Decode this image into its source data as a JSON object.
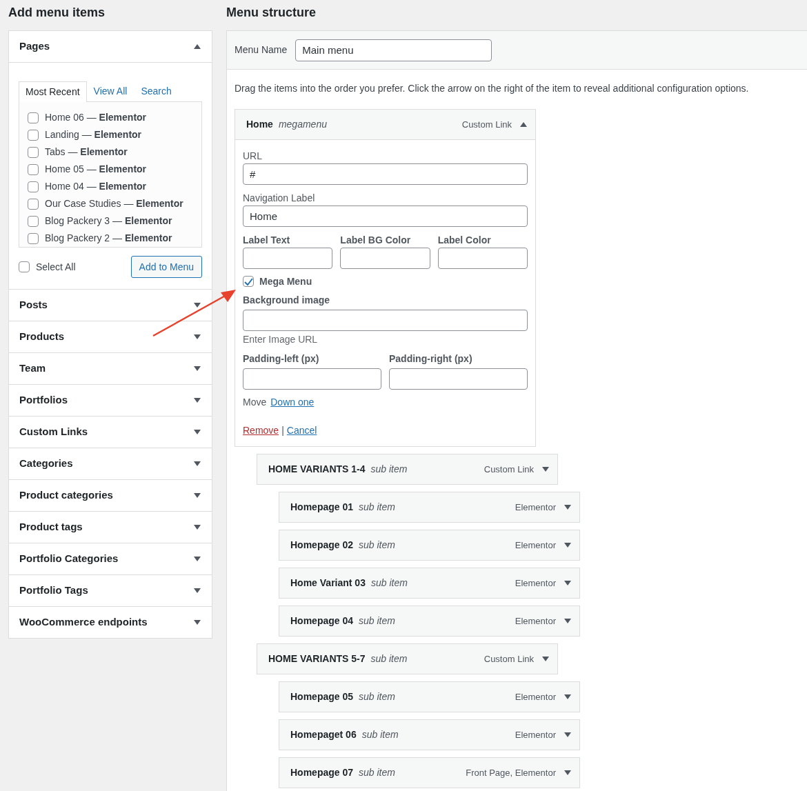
{
  "add_menu_items": {
    "title": "Add menu items",
    "sections": [
      {
        "title": "Pages",
        "expanded": true,
        "tabs": [
          {
            "label": "Most Recent",
            "selected": true
          },
          {
            "label": "View All",
            "selected": false
          },
          {
            "label": "Search",
            "selected": false
          }
        ],
        "pages": [
          {
            "label": "Home 06 — **Elementor**",
            "checked": false
          },
          {
            "label": "Landing — **Elementor**",
            "checked": false
          },
          {
            "label": "Tabs — **Elementor**",
            "checked": false
          },
          {
            "label": "Home 05 — **Elementor**",
            "checked": false
          },
          {
            "label": "Home 04 — **Elementor**",
            "checked": false
          },
          {
            "label": "Our Case Studies — **Elementor**",
            "checked": false
          },
          {
            "label": "Blog Packery 3 — **Elementor**",
            "checked": false
          },
          {
            "label": "Blog Packery 2 — **Elementor**",
            "checked": false
          }
        ],
        "select_all": {
          "label": "Select All",
          "checked": false
        },
        "button": "Add to Menu"
      },
      {
        "title": "Posts",
        "expanded": false
      },
      {
        "title": "Products",
        "expanded": false
      },
      {
        "title": "Team",
        "expanded": false
      },
      {
        "title": "Portfolios",
        "expanded": false
      },
      {
        "title": "Custom Links",
        "expanded": false
      },
      {
        "title": "Categories",
        "expanded": false
      },
      {
        "title": "Product categories",
        "expanded": false
      },
      {
        "title": "Product tags",
        "expanded": false
      },
      {
        "title": "Portfolio Categories",
        "expanded": false
      },
      {
        "title": "Portfolio Tags",
        "expanded": false
      },
      {
        "title": "WooCommerce endpoints",
        "expanded": false
      }
    ]
  },
  "menu_structure": {
    "title": "Menu structure",
    "menu_name": {
      "label": "Menu Name",
      "value": "Main menu"
    },
    "instructions": "Drag the items into the order you prefer. Click the arrow on the right of the item to reveal additional configuration options.",
    "items": [
      {
        "title": "Home",
        "subtitle": "megamenu",
        "type": "Custom Link",
        "expanded": true,
        "settings": {
          "url": {
            "label": "URL",
            "value": "#"
          },
          "navigation_label": {
            "label": "Navigation Label",
            "value": "Home"
          },
          "label_fields": [
            {
              "label": "Label Text"
            },
            {
              "label": "Label BG Color"
            },
            {
              "label": "Label Color"
            }
          ],
          "mega_menu": {
            "label": "Mega Menu",
            "checked": true
          },
          "background_image": {
            "label": "Background image",
            "hint": "Enter Image URL"
          },
          "padding_fields": [
            {
              "label": "Padding-left (px)"
            },
            {
              "label": "Padding-right (px)"
            }
          ],
          "move": {
            "label": "Move",
            "link": "Down one"
          },
          "actions": {
            "remove": "Remove",
            "separator": "|",
            "cancel": "Cancel"
          }
        },
        "children": [
          {
            "title": "HOME VARIANTS 1-4",
            "subtitle": "sub item",
            "type": "Custom Link",
            "expanded": false,
            "children": [
              {
                "title": "Homepage 01",
                "subtitle": "sub item",
                "type": "Elementor",
                "expanded": false
              },
              {
                "title": "Homepage 02",
                "subtitle": "sub item",
                "type": "Elementor",
                "expanded": false
              },
              {
                "title": "Home Variant 03",
                "subtitle": "sub item",
                "type": "Elementor",
                "expanded": false
              },
              {
                "title": "Homepage 04",
                "subtitle": "sub item",
                "type": "Elementor",
                "expanded": false
              }
            ]
          },
          {
            "title": "HOME VARIANTS 5-7",
            "subtitle": "sub item",
            "type": "Custom Link",
            "expanded": false,
            "children": [
              {
                "title": "Homepage 05",
                "subtitle": "sub item",
                "type": "Elementor",
                "expanded": false
              },
              {
                "title": "Homepaget 06",
                "subtitle": "sub item",
                "type": "Elementor",
                "expanded": false
              },
              {
                "title": "Homepage 07",
                "subtitle": "sub item",
                "type": "Front Page, Elementor",
                "expanded": false
              }
            ]
          }
        ]
      }
    ]
  }
}
